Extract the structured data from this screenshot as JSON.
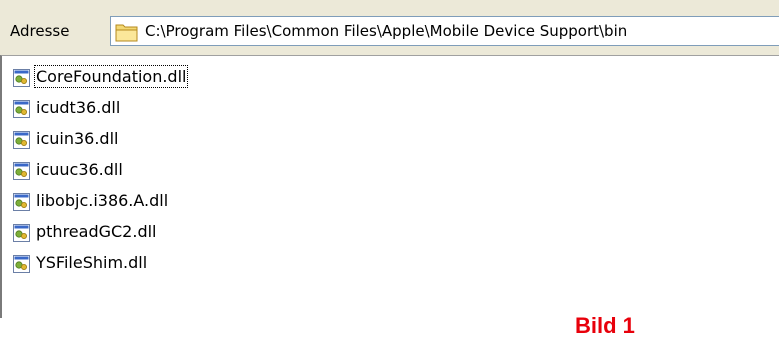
{
  "address_bar": {
    "label": "Adresse",
    "path": "C:\\Program Files\\Common Files\\Apple\\Mobile Device Support\\bin",
    "folder_icon": "folder-icon"
  },
  "files": [
    {
      "name": "CoreFoundation.dll",
      "icon": "dll-file-icon",
      "focused": true
    },
    {
      "name": "icudt36.dll",
      "icon": "dll-file-icon"
    },
    {
      "name": "icuin36.dll",
      "icon": "dll-file-icon"
    },
    {
      "name": "icuuc36.dll",
      "icon": "dll-file-icon"
    },
    {
      "name": "libobjc.i386.A.dll",
      "icon": "dll-file-icon"
    },
    {
      "name": "pthreadGC2.dll",
      "icon": "dll-file-icon"
    },
    {
      "name": "YSFileShim.dll",
      "icon": "dll-file-icon"
    }
  ],
  "caption": "Bild 1",
  "colors": {
    "caption": "#e8000b",
    "toolbar_bg": "#ece9d8",
    "field_border": "#7f9db9"
  }
}
